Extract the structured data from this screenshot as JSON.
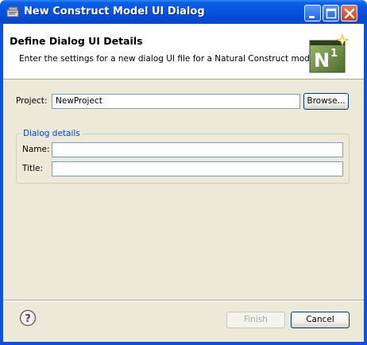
{
  "window": {
    "title": "New Construct Model UI Dialog",
    "accent": "#0a53d9"
  },
  "header": {
    "title": "Define Dialog UI Details",
    "description": "Enter the settings for a new dialog UI file for a Natural Construct model.",
    "logo": {
      "letter": "N",
      "superscript": "1",
      "icon": "natural-construct-logo"
    }
  },
  "form": {
    "project_label": "Project:",
    "project_value": "NewProject",
    "browse_label": "Browse...",
    "group_title": "Dialog details",
    "name_label": "Name:",
    "name_value": "",
    "title_label": "Title:",
    "title_value": ""
  },
  "footer": {
    "help_icon": "help-icon",
    "finish_label": "Finish",
    "finish_enabled": false,
    "cancel_label": "Cancel"
  }
}
